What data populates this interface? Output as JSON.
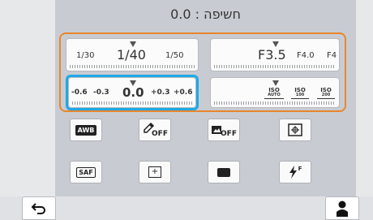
{
  "header": {
    "title": "חשיפה : 0.0"
  },
  "shutter": {
    "values": [
      "1/30",
      "1/40",
      "1/50"
    ]
  },
  "aperture": {
    "values": [
      "F3.5",
      "F4.0",
      "F4"
    ]
  },
  "exposure": {
    "values": [
      "-0.6",
      "-0.3",
      "0.0",
      "+0.3",
      "+0.6"
    ]
  },
  "iso": {
    "values": [
      {
        "top": "ISO",
        "bottom": "AUTO"
      },
      {
        "top": "ISO",
        "bottom": "100"
      },
      {
        "top": "ISO",
        "bottom": "200"
      }
    ]
  },
  "icons_row1": [
    {
      "name": "white-balance-auto-icon",
      "text": "AWB"
    },
    {
      "name": "picture-wizard-off-icon",
      "text": "OFF"
    },
    {
      "name": "smart-filter-off-icon",
      "text": "OFF"
    },
    {
      "name": "metering-icon",
      "text": ""
    }
  ],
  "icons_row2": [
    {
      "name": "autofocus-saf-icon",
      "text": "SAF"
    },
    {
      "name": "af-area-icon",
      "text": "+"
    },
    {
      "name": "aspect-ratio-icon",
      "text": ""
    },
    {
      "name": "flash-icon",
      "text": "F"
    }
  ],
  "colors": {
    "accent_orange": "#e8862c",
    "accent_blue": "#1ea9e6"
  }
}
